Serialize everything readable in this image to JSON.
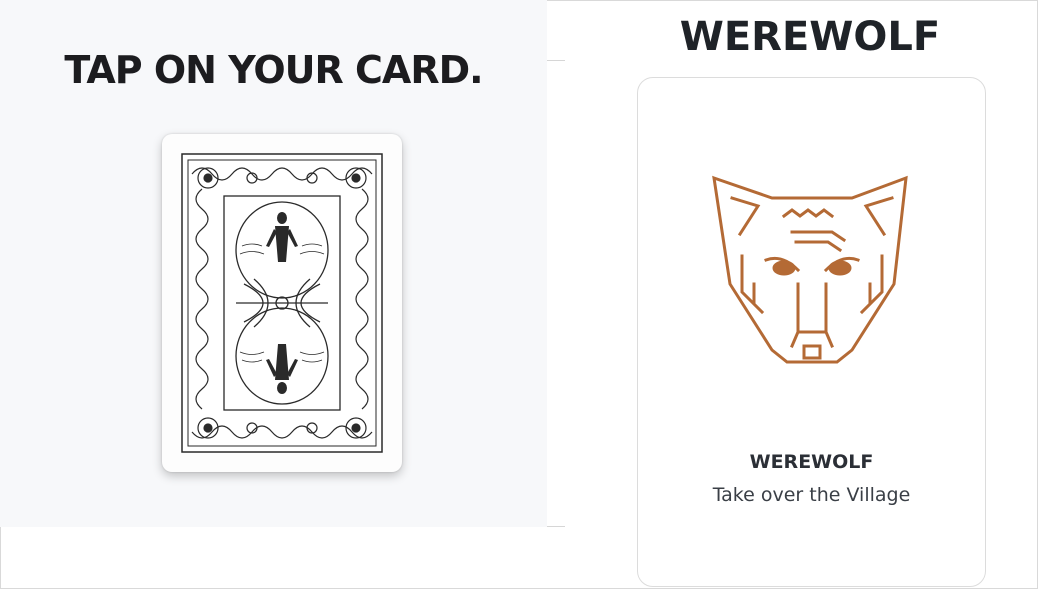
{
  "left": {
    "instruction_title": "TAP ON YOUR CARD."
  },
  "right": {
    "heading": "WEREWOLF",
    "card": {
      "name": "WEREWOLF",
      "description": "Take over the Village",
      "icon": "wolf-head-icon",
      "icon_color": "#b46a35"
    }
  }
}
